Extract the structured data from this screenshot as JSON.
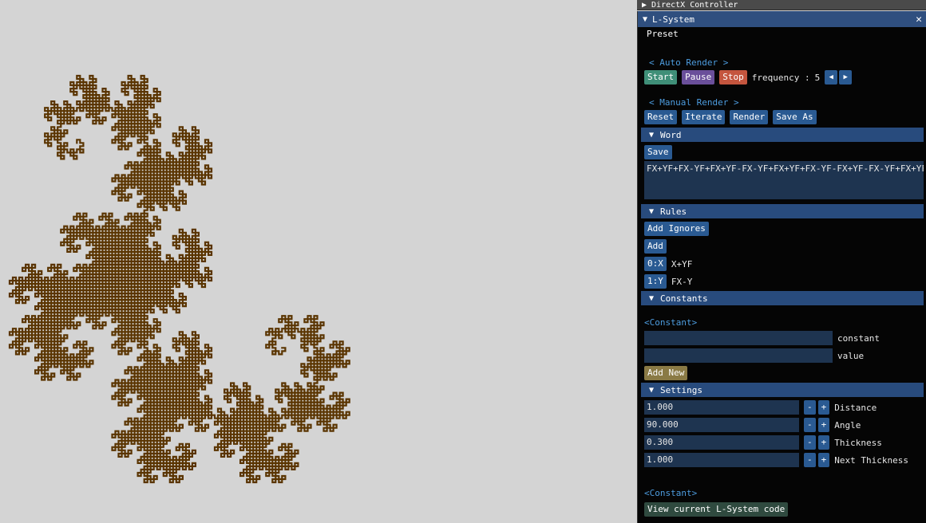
{
  "directx_panel": {
    "title": "DirectX Controller"
  },
  "lsystem": {
    "title": "L-System",
    "preset_label": "Preset",
    "auto_render": {
      "header": "< Auto Render >",
      "start": "Start",
      "pause": "Pause",
      "stop": "Stop",
      "frequency_label": "frequency :",
      "frequency_value": "5"
    },
    "manual_render": {
      "header": "< Manual Render >",
      "reset": "Reset",
      "iterate": "Iterate",
      "render": "Render",
      "save_as": "Save As"
    },
    "word": {
      "header": "Word",
      "save": "Save",
      "value": "FX+YF+FX-YF+FX+YF-FX-YF+FX+YF+FX-YF-FX+YF-FX-YF+FX+YF"
    },
    "rules": {
      "header": "Rules",
      "add_ignores": "Add Ignores",
      "add": "Add",
      "items": [
        {
          "key": "0:X",
          "value": "X+YF"
        },
        {
          "key": "1:Y",
          "value": "FX-Y"
        }
      ]
    },
    "constants": {
      "header": "Constants",
      "link": "<Constant>",
      "constant_label": "constant",
      "value_label": "value",
      "add_new": "Add New"
    },
    "settings": {
      "header": "Settings",
      "items": [
        {
          "value": "1.000",
          "label": "Distance"
        },
        {
          "value": "90.000",
          "label": "Angle"
        },
        {
          "value": "0.300",
          "label": "Thickness"
        },
        {
          "value": "1.000",
          "label": "Next Thickness"
        }
      ],
      "minus": "-",
      "plus": "+"
    },
    "footer": {
      "link": "<Constant>",
      "view_code": "View current L-System code"
    }
  },
  "colors": {
    "canvas_bg": "#d4d4d4",
    "fractal": "#5a3400",
    "panel_bg": "#050505",
    "header_blue": "#284b7d",
    "button_blue": "#2a5a92"
  }
}
